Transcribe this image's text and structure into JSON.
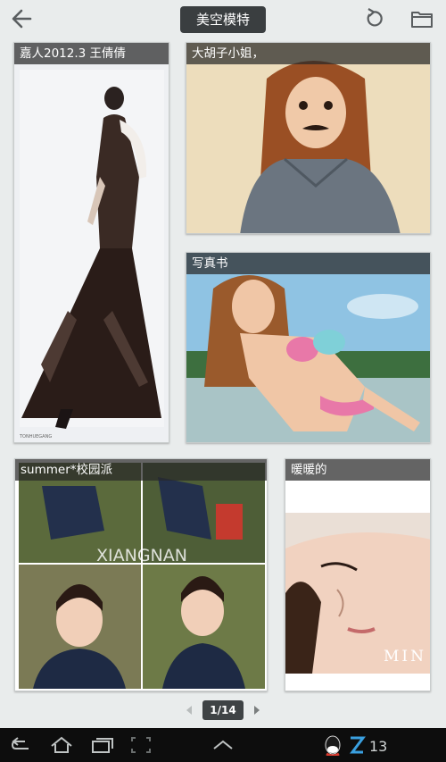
{
  "header": {
    "title": "美空模特",
    "back_icon": "arrow-left-icon",
    "refresh_icon": "refresh-icon",
    "folder_icon": "folder-icon"
  },
  "albums": [
    {
      "title": "嘉人2012.3 王倩倩",
      "image": "fashion-model-black-lace-dress",
      "watermark": "TONHUEGANG"
    },
    {
      "title": "大胡子小姐，",
      "image": "girl-mustache-denim-shirt"
    },
    {
      "title": "写真书",
      "image": "girl-bikini-beach"
    },
    {
      "title": "summer*校园派",
      "image": "collage-girl-navy-blazer",
      "watermark": "XIANGNAN"
    },
    {
      "title": "暖暖的",
      "image": "girl-closeup-portrait",
      "watermark": "MIN"
    }
  ],
  "pager": {
    "current": "1/14"
  },
  "system_bar": {
    "time": "13",
    "icons": [
      "back-icon",
      "home-icon",
      "recent-apps-icon",
      "screenshot-icon",
      "up-arrow-icon",
      "qq-icon",
      "z-logo-icon"
    ]
  },
  "colors": {
    "background": "#e9ecec",
    "caption_bg": "#282828",
    "pill_bg": "#3a3e40",
    "navbar": "#0d0d0d"
  }
}
